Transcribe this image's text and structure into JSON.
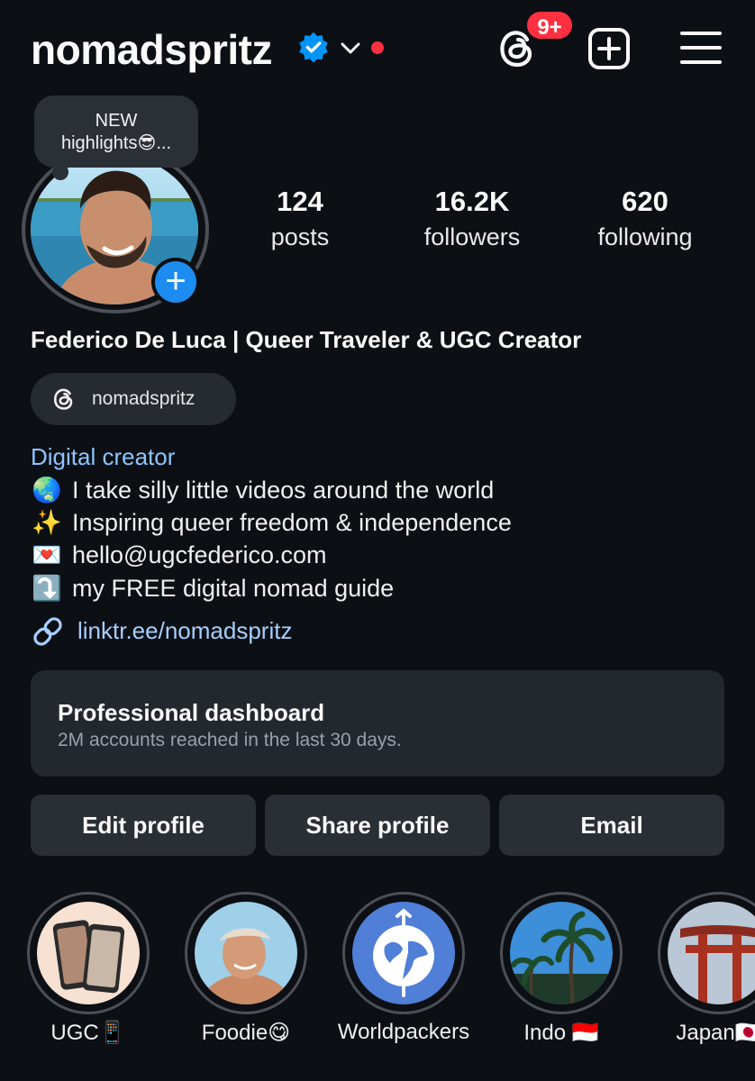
{
  "header": {
    "username": "nomadspritz",
    "notification_badge": "9+",
    "icons": [
      "verified-badge-icon",
      "chevron-down-icon",
      "threads-icon",
      "create-post-icon",
      "hamburger-menu-icon"
    ]
  },
  "note": {
    "line1": "NEW",
    "line2": "highlights😎..."
  },
  "stats": {
    "posts_count": "124",
    "posts_label": "posts",
    "followers_count": "16.2K",
    "followers_label": "followers",
    "following_count": "620",
    "following_label": "following"
  },
  "profile": {
    "full_name": "Federico De Luca | Queer Traveler & UGC Creator",
    "threads_handle": "nomadspritz",
    "category": "Digital creator",
    "bio": [
      {
        "emoji": "🌏",
        "text": "I take silly little videos around the world"
      },
      {
        "emoji": "✨",
        "text": "Inspiring queer freedom & independence"
      },
      {
        "emoji": "💌",
        "text": "hello@ugcfederico.com"
      },
      {
        "emoji": "⤵️",
        "text": "my FREE digital nomad guide"
      }
    ],
    "link": "linktr.ee/nomadspritz"
  },
  "dashboard": {
    "title": "Professional dashboard",
    "subtitle": "2M accounts reached in the last 30 days."
  },
  "buttons": {
    "edit": "Edit profile",
    "share": "Share profile",
    "email": "Email"
  },
  "highlights": [
    {
      "label": "UGC📱"
    },
    {
      "label": "Foodie😋"
    },
    {
      "label": "Worldpackers"
    },
    {
      "label": "Indo 🇮🇩"
    },
    {
      "label": "Japan🇯🇵"
    }
  ],
  "colors": {
    "background": "#0c0f14",
    "badge_red": "#ff3040",
    "verified_blue": "#0095f6",
    "link_blue": "#a7cffd",
    "add_story_blue": "#1d8cf0"
  }
}
